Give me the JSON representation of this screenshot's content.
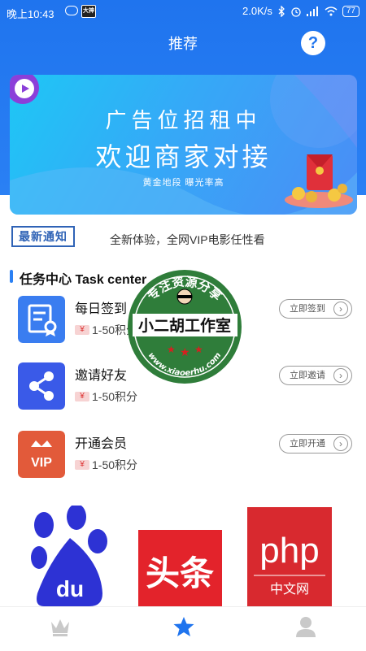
{
  "status_bar": {
    "time": "晚上10:43",
    "app_badge": "大神",
    "speed": "2.0K/s",
    "battery": "77"
  },
  "header": {
    "title": "推荐",
    "help_symbol": "?"
  },
  "banner": {
    "line1": "广告位招租中",
    "line2": "欢迎商家对接",
    "line3": "黄金地段 曝光率高"
  },
  "notice": {
    "badge": "最新通知",
    "text": "全新体验，全网VIP电影任性看"
  },
  "task_center": {
    "title": "任务中心 Task center",
    "items": [
      {
        "name": "每日签到",
        "reward": "1-50积分",
        "button": "立即签到",
        "icon": "certificate-icon"
      },
      {
        "name": "邀请好友",
        "reward": "1-50积分",
        "button": "立即邀请",
        "icon": "share-icon"
      },
      {
        "name": "开通会员",
        "reward": "1-50积分",
        "button": "立即开通",
        "icon": "vip-icon"
      }
    ],
    "currency_glyph": "¥"
  },
  "watermark": {
    "top": "专注资源分享",
    "middle": "小二胡工作室",
    "bottom": "www.xiaoerhu.com"
  },
  "ads": {
    "baidu": "du",
    "toutiao": "头条",
    "php_main": "php",
    "php_sub": "中文网"
  },
  "tabbar": {
    "items": [
      "crown-icon",
      "star-icon",
      "user-icon"
    ],
    "active": "star-icon"
  },
  "colors": {
    "primary": "#2a80f4",
    "badge": "#2f63b6",
    "share": "#3a5ae8",
    "vip": "#e25a3a"
  }
}
